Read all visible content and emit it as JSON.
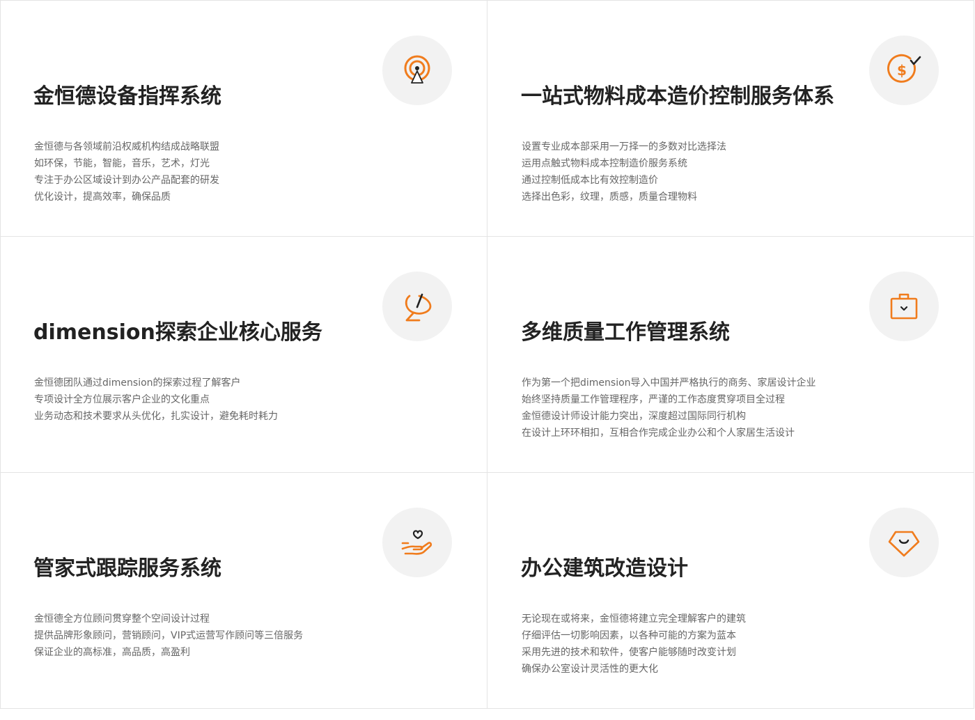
{
  "accent_color": "#f07c1d",
  "cards": [
    {
      "icon": "signal-tower-icon",
      "title": "金恒德设备指挥系统",
      "lines": [
        "金恒德与各领域前沿权威机构结成战略联盟",
        "如环保，节能，智能，音乐，艺术，灯光",
        "专注于办公区域设计到办公产品配套的研发",
        "优化设计，提高效率，确保品质"
      ]
    },
    {
      "icon": "dollar-check-icon",
      "title": "一站式物料成本造价控制服务体系",
      "lines": [
        "设置专业成本部采用一万择一的多数对比选择法",
        "运用点触式物料成本控制造价服务系统",
        "通过控制低成本比有效控制造价",
        "选择出色彩，纹理，质感，质量合理物料"
      ]
    },
    {
      "icon": "satellite-dish-icon",
      "title": "dimension探索企业核心服务",
      "lines": [
        "金恒德团队通过dimension的探索过程了解客户",
        "专项设计全方位展示客户企业的文化重点",
        "业务动态和技术要求从头优化，扎实设计，避免耗时耗力"
      ]
    },
    {
      "icon": "briefcase-icon",
      "title": "多维质量工作管理系统",
      "lines": [
        "作为第一个把dimension导入中国并严格执行的商务、家居设计企业",
        "始终坚持质量工作管理程序，严谨的工作态度贯穿项目全过程",
        "金恒德设计师设计能力突出，深度超过国际同行机构",
        "在设计上环环相扣，互相合作完成企业办公和个人家居生活设计"
      ]
    },
    {
      "icon": "hand-heart-icon",
      "title": "管家式跟踪服务系统",
      "lines": [
        "金恒德全方位顾问贯穿整个空间设计过程",
        "提供品牌形象顾问，营销顾问，VIP式运营写作顾问等三倍服务",
        "保证企业的高标准，高品质，高盈利"
      ]
    },
    {
      "icon": "gem-icon",
      "title": "办公建筑改造设计",
      "lines": [
        "无论现在或将来，金恒德将建立完全理解客户的建筑",
        "仔细评估一切影响因素，以各种可能的方案为蓝本",
        "采用先进的技术和软件，使客户能够随时改变计划",
        "确保办公室设计灵活性的更大化"
      ]
    }
  ]
}
